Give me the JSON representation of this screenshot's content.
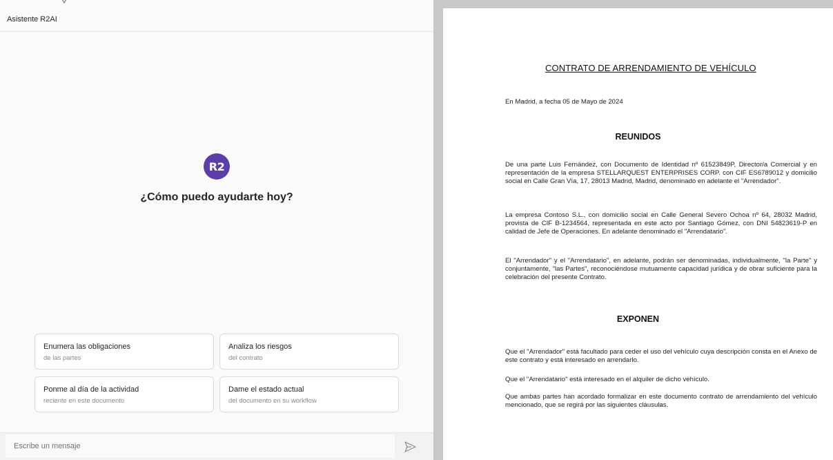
{
  "chat": {
    "title": "Asistente R2AI",
    "logo_text": "R2",
    "welcome": "¿Cómo puedo ayudarte hoy?",
    "suggestions": [
      {
        "title": "Enumera las obligaciones",
        "subtitle": "de las partes"
      },
      {
        "title": "Analiza los riesgos",
        "subtitle": "del contrato"
      },
      {
        "title": "Ponme al día de la actividad",
        "subtitle": "reciente en este documento"
      },
      {
        "title": "Dame el estado actual",
        "subtitle": "del documento en su workflow"
      }
    ],
    "input_placeholder": "Escribe un mensaje",
    "send_icon": "send-icon"
  },
  "document": {
    "title": "CONTRATO DE ARRENDAMIENTO DE VEHÍCULO",
    "date_line": "En Madrid, a fecha 05 de Mayo de 2024",
    "section1_heading": "REUNIDOS",
    "section1_paragraphs": [
      "De una parte Luis Fernández, con Documento de Identidad nº 61523849P, Director/a Comercial y en representación de la empresa STELLARQUEST ENTERPRISES CORP. con CIF ES6789012 y domicilio social en Calle Gran Vía, 17, 28013 Madrid, Madrid, denominado en adelante el \"Arrendador\".",
      "La empresa Contoso S.L., con domicilio social en Calle General Severo Ochoa nº 64, 28032 Madrid, provista de CIF B-1234564, representada en este acto por Santiago Gómez, con DNI 54823619-P en calidad de Jefe de Operaciones. En adelante denominado el \"Arrendatario\".",
      "El \"Arrendador\" y el \"Arrendatario\", en adelante, podrán ser denominadas, individualmente, \"la Parte\" y conjuntamente, \"las Partes\", reconociéndose mutuamente capacidad jurídica y de obrar suficiente para la celebración del presente Contrato."
    ],
    "section2_heading": "EXPONEN",
    "section2_paragraphs": [
      "Que el \"Arrendador\" está facultado para ceder el uso del vehículo cuya descripción consta en el Anexo de este contrato y está interesado en arrendarlo.",
      "Que el \"Arrendatario\" está interesado en el alquiler de dicho vehículo.",
      "Que ambas partes han acordado formalizar en este documento contrato de arrendamiento del vehículo mencionado, que se regirá por las siguientes cláusulas."
    ]
  },
  "colors": {
    "brand": "#5b3ea8",
    "chat_background": "#fafafa",
    "divider": "#c8c8c8"
  }
}
